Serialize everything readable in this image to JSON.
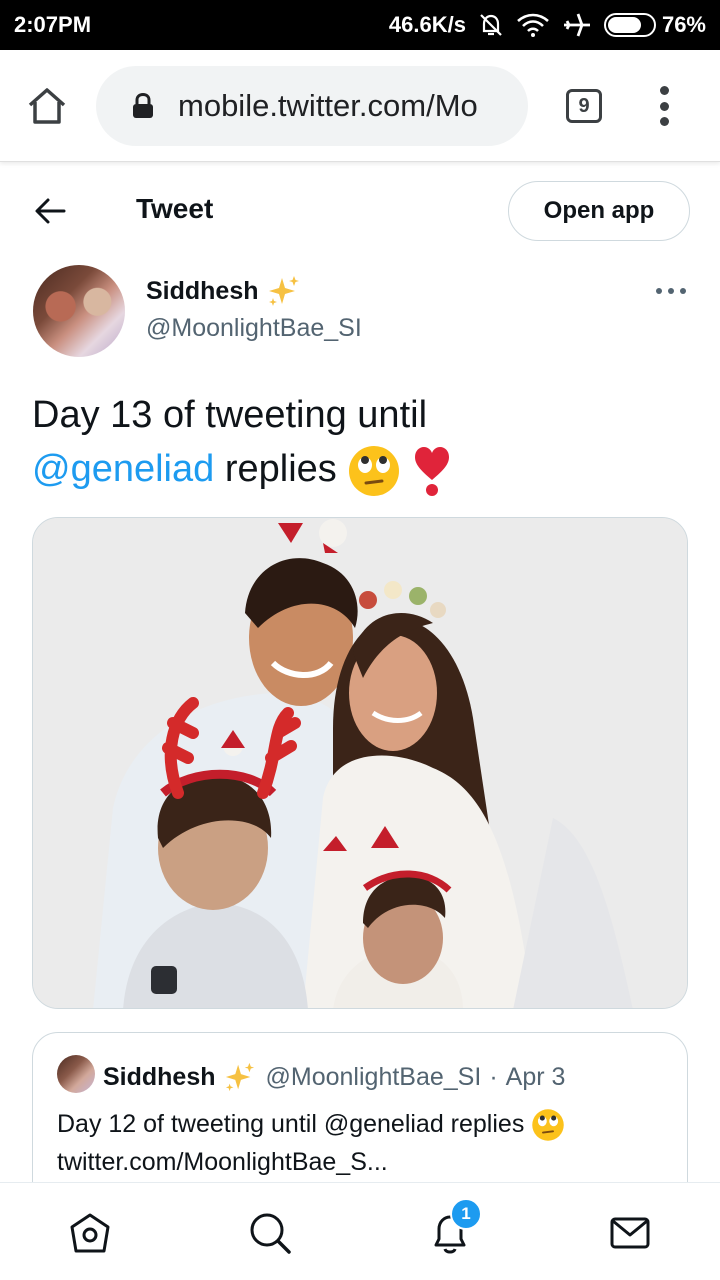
{
  "status_bar": {
    "time": "2:07PM",
    "network_speed": "46.6K/s",
    "battery_percent": "76%",
    "battery_level": 0.76
  },
  "browser": {
    "url": "mobile.twitter.com/Mo",
    "tab_count": "9"
  },
  "header": {
    "title": "Tweet",
    "open_app_label": "Open app"
  },
  "tweet": {
    "author_name": "Siddhesh",
    "author_handle": "@MoonlightBae_SI",
    "text_before": "Day 13 of tweeting until",
    "mention": "@geneliad",
    "text_after": " replies"
  },
  "quote": {
    "author_name": "Siddhesh",
    "author_handle": "@MoonlightBae_SI",
    "separator": "·",
    "date": "Apr 3",
    "line1": "Day 12 of tweeting until @geneliad replies",
    "line2": "twitter.com/MoonlightBae_S..."
  },
  "nav": {
    "notification_count": "1"
  },
  "icons": [
    "home-icon",
    "lock-icon",
    "tabs-icon",
    "menu-icon",
    "back-arrow-icon",
    "sparkles-icon",
    "more-icon",
    "eye-roll-emoji",
    "heart-exclamation-emoji",
    "explore-icon",
    "bell-icon",
    "mail-icon",
    "wifi-icon",
    "airplane-icon",
    "mute-bell-icon",
    "battery-icon"
  ],
  "colors": {
    "accent": "#1d9bf0",
    "text": "#0f1419",
    "secondary": "#536471",
    "border": "#cfd9de"
  }
}
